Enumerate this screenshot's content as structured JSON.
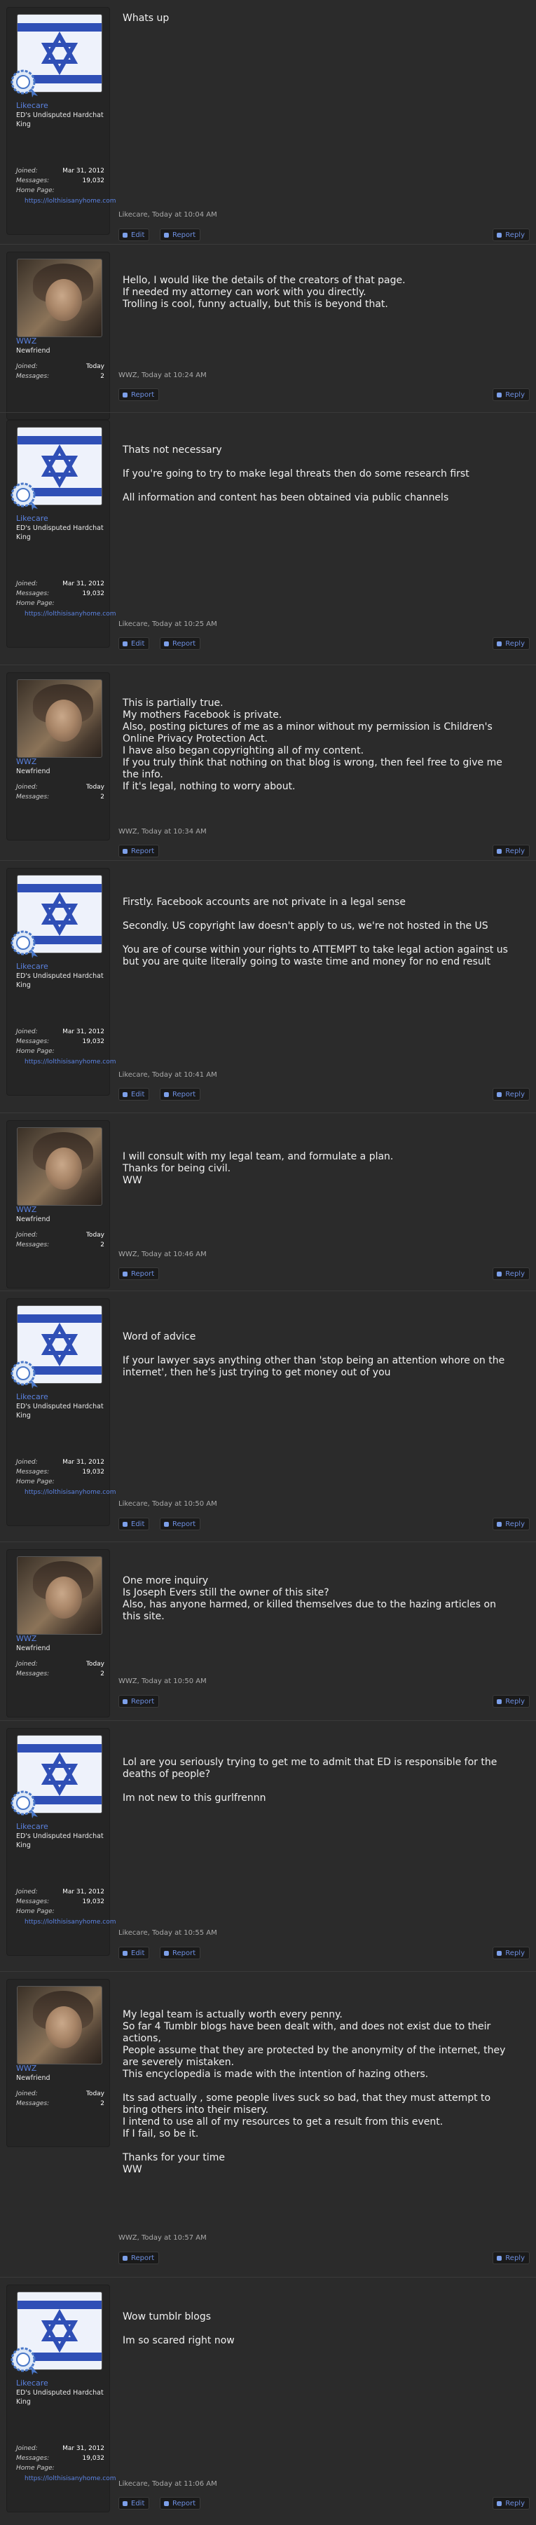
{
  "posts": [
    {
      "user": "likecare",
      "body": "Whats up",
      "meta": "Likecare, Today at 10:04 AM",
      "buttons": [
        "Edit",
        "Report"
      ],
      "reply": "Reply"
    },
    {
      "user": "wwz",
      "body": "Hello, I would like the details of the creators of that page.\nIf needed my attorney can work with you directly.\nTrolling is cool, funny actually, but this is beyond that.",
      "meta": "WWZ, Today at 10:24 AM",
      "buttons": [
        "Report"
      ],
      "reply": "Reply"
    },
    {
      "user": "likecare",
      "body": "Thats not necessary\n\nIf you're going to try to make legal threats then do some research first\n\nAll information and content has been obtained via public channels",
      "meta": "Likecare, Today at 10:25 AM",
      "buttons": [
        "Edit",
        "Report"
      ],
      "reply": "Reply"
    },
    {
      "user": "wwz",
      "body": "This is partially true.\nMy mothers Facebook is private.\nAlso, posting pictures of me as a minor without my permission is Children's Online Privacy Protection Act.\nI have also began copyrighting all of my content.\nIf you truly think that nothing on that blog is wrong, then feel free to give me the info.\nIf it's legal, nothing to worry about.",
      "meta": "WWZ, Today at 10:34 AM",
      "buttons": [
        "Report"
      ],
      "reply": "Reply"
    },
    {
      "user": "likecare",
      "body": "Firstly. Facebook accounts are not private in a legal sense\n\nSecondly. US copyright law doesn't apply to us, we're not hosted in the US\n\nYou are of course within your rights to ATTEMPT to take legal action against us but you are quite literally going to waste time and money for no end result",
      "meta": "Likecare, Today at 10:41 AM",
      "buttons": [
        "Edit",
        "Report"
      ],
      "reply": "Reply"
    },
    {
      "user": "wwz",
      "body": "I will consult with my legal team, and formulate a plan.\nThanks for being civil.\nWW",
      "meta": "WWZ, Today at 10:46 AM",
      "buttons": [
        "Report"
      ],
      "reply": "Reply"
    },
    {
      "user": "likecare",
      "body": "Word of advice\n\nIf your lawyer says anything other than 'stop being an attention whore on the internet', then he's just trying to get money out of you",
      "meta": "Likecare, Today at 10:50 AM",
      "buttons": [
        "Edit",
        "Report"
      ],
      "reply": "Reply"
    },
    {
      "user": "wwz",
      "body": "One more inquiry\nIs Joseph Evers still the owner of this site?\nAlso, has anyone harmed, or killed themselves due to the hazing articles on this site.",
      "meta": "WWZ, Today at 10:50 AM",
      "buttons": [
        "Report"
      ],
      "reply": "Reply"
    },
    {
      "user": "likecare",
      "body": "Lol are you seriously trying to get me to admit that ED is responsible for the deaths of people?\n\nIm not new to this gurlfrennn",
      "meta": "Likecare, Today at 10:55 AM",
      "buttons": [
        "Edit",
        "Report"
      ],
      "reply": "Reply"
    },
    {
      "user": "wwz",
      "body": "My legal team is actually worth every penny.\nSo far 4 Tumblr blogs have been dealt with, and does not exist due to their actions,\nPeople assume that they are protected by the anonymity of the internet, they are severely mistaken.\nThis encyclopedia is made with the intention of hazing others.\n\nIts sad actually , some people lives suck so bad, that they must attempt to bring others into their misery.\nI intend to use all of my resources to get a result from this event.\nIf I fail, so be it.\n\nThanks for your time\nWW",
      "meta": "WWZ, Today at 10:57 AM",
      "buttons": [
        "Report"
      ],
      "reply": "Reply"
    },
    {
      "user": "likecare",
      "body": "Wow tumblr blogs\n\nIm so scared right now",
      "meta": "Likecare, Today at 11:06 AM",
      "buttons": [
        "Edit",
        "Report"
      ],
      "reply": "Reply"
    }
  ],
  "users": {
    "likecare": {
      "name": "Likecare",
      "title": "ED's Undisputed Hardchat King",
      "avatar": "star-of-david-flag",
      "stats": [
        {
          "label": "Joined:",
          "value": "Mar 31, 2012"
        },
        {
          "label": "Messages:",
          "value": "19,032"
        }
      ],
      "homepage_label": "Home Page:",
      "homepage": "https://lolthisisanyhome.com"
    },
    "wwz": {
      "name": "WWZ",
      "title": "Newfriend",
      "avatar": "user-photo",
      "stats": [
        {
          "label": "Joined:",
          "value": "Today"
        },
        {
          "label": "Messages:",
          "value": "2"
        }
      ]
    }
  },
  "colors": {
    "background": "#2b2b2b",
    "username": "#5b82e0",
    "link": "#6e8fe0",
    "flag_blue": "#2f4fb6"
  }
}
